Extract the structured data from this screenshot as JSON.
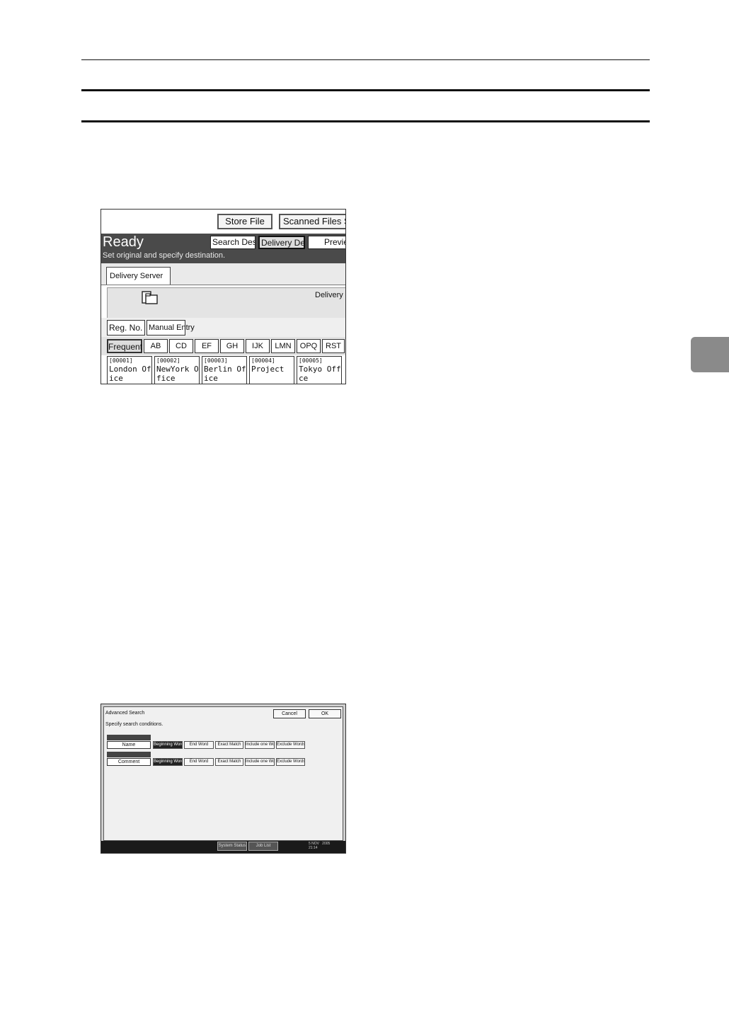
{
  "screenshot_1": {
    "top_buttons": [
      "Store File",
      "Scanned Files Sta"
    ],
    "status_title": "Ready",
    "status_message": "Set original and specify destination.",
    "header_buttons": [
      "Search Dest.",
      "Delivery Dest.",
      "Previe"
    ],
    "tab_label": "Delivery Server",
    "delivery_label": "Delivery S",
    "small_buttons": [
      "Reg. No.",
      "Manual Entry"
    ],
    "alpha_tabs": [
      "Frequent",
      "AB",
      "CD",
      "EF",
      "GH",
      "IJK",
      "LMN",
      "OPQ",
      "RST"
    ],
    "destinations": [
      {
        "id": "[00001]",
        "name": "London Off\nice"
      },
      {
        "id": "[00002]",
        "name": "NewYork Of\nfice"
      },
      {
        "id": "[00003]",
        "name": "Berlin Off\nice"
      },
      {
        "id": "[00004]",
        "name": "Project"
      },
      {
        "id": "[00005]",
        "name": "Tokyo Offi\nce"
      }
    ]
  },
  "screenshot_2": {
    "title": "Advanced Search",
    "subtitle": "Specify search conditions.",
    "top_buttons": [
      "Cancel",
      "OK"
    ],
    "rows": [
      {
        "field": "Name",
        "options": [
          "Beginning Word",
          "End Word",
          "Exact Match",
          "Include one Word",
          "Exclude Words"
        ],
        "selected": 0
      },
      {
        "field": "Comment",
        "options": [
          "Beginning Word",
          "End Word",
          "Exact Match",
          "Include one Word",
          "Exclude Words"
        ],
        "selected": 0
      }
    ],
    "status_buttons": [
      "System Status",
      "Job List"
    ],
    "datetime": "5 NOV   2005\n21:14"
  },
  "icons": {
    "folder": "folder-icon"
  }
}
